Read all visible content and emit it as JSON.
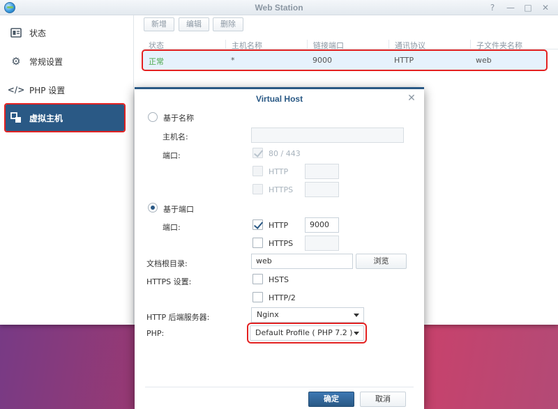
{
  "window": {
    "title": "Web Station",
    "help": "?",
    "minimize": "—",
    "maximize": "□",
    "close": "✕"
  },
  "sidebar": {
    "items": [
      {
        "label": "状态",
        "icon": "status-icon"
      },
      {
        "label": "常规设置",
        "icon": "gear-icon"
      },
      {
        "label": "PHP 设置",
        "icon": "code-icon"
      },
      {
        "label": "虚拟主机",
        "icon": "virtual-host-icon",
        "active": true
      }
    ]
  },
  "toolbar": {
    "add": "新增",
    "edit": "编辑",
    "delete": "删除"
  },
  "table": {
    "headers": [
      "状态",
      "主机名称",
      "链接端口",
      "通讯协议",
      "子文件夹名称"
    ],
    "rows": [
      {
        "status": "正常",
        "host": "*",
        "port": "9000",
        "protocol": "HTTP",
        "folder": "web"
      }
    ]
  },
  "dialog": {
    "title": "Virtual Host",
    "name_based": {
      "label": "基于名称",
      "hostname_label": "主机名:",
      "hostname_value": "",
      "port_label": "端口:",
      "port_default": "80 / 443",
      "http": "HTTP",
      "https": "HTTPS"
    },
    "port_based": {
      "label": "基于端口",
      "port_label": "端口:",
      "http": "HTTP",
      "http_port": "9000",
      "https": "HTTPS",
      "https_port": ""
    },
    "docroot": {
      "label": "文档根目录:",
      "value": "web",
      "browse": "浏览"
    },
    "https_settings": {
      "label": "HTTPS 设置:",
      "hsts": "HSTS",
      "http2": "HTTP/2"
    },
    "backend": {
      "label": "HTTP 后端服务器:",
      "value": "Nginx"
    },
    "php": {
      "label": "PHP:",
      "value": "Default Profile ( PHP 7.2 )"
    },
    "ok": "确定",
    "cancel": "取消"
  },
  "colors": {
    "accent": "#2a5985",
    "highlight": "#e32222",
    "status_ok": "#4aa84a"
  }
}
